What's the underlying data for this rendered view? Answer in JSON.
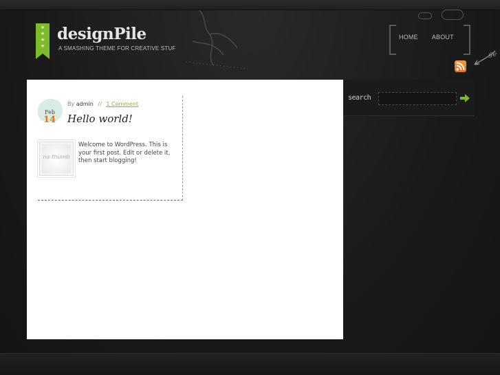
{
  "site": {
    "title": "designPile",
    "tagline": "A SMASHING THEME FOR CREATIVE STUF"
  },
  "nav": {
    "items": [
      {
        "label": "HOME"
      },
      {
        "label": "ABOUT"
      }
    ]
  },
  "rss": {
    "icon": "rss-icon"
  },
  "post": {
    "date_month": "Feb",
    "date_day": "14",
    "by_label": "By",
    "author": "admin",
    "separator": "//",
    "comments": "1 Comment",
    "title": "Hello world!",
    "thumbnail_text": "no thumb",
    "excerpt": "Welcome to WordPress. This is your first post. Edit or delete it, then start blogging!"
  },
  "sidebar": {
    "search_label": "search",
    "search_value": "",
    "search_button_icon": "arrow-right-icon"
  },
  "colors": {
    "accent": "#7dbb2a",
    "date_day": "#e0731f",
    "rss": "#f08a2c"
  }
}
